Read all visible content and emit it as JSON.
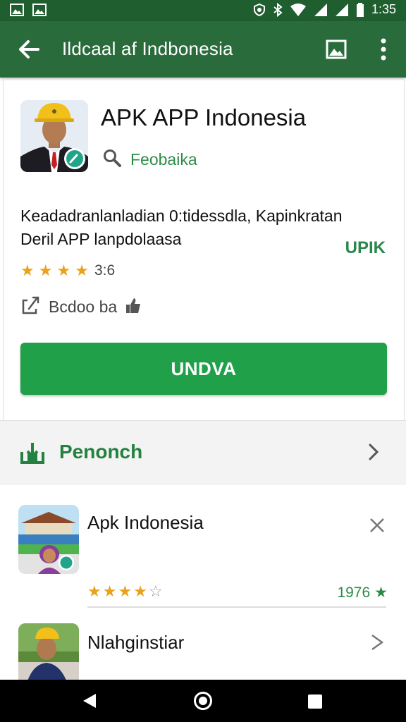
{
  "status_bar": {
    "time": "1:35",
    "icons": [
      "image-icon",
      "image-icon",
      "alarm-icon",
      "bluetooth-icon",
      "wifi-icon",
      "signal-icon",
      "signal-icon",
      "battery-icon"
    ]
  },
  "app_bar": {
    "title": "Ildcaal af Indbonesia",
    "back_icon": "arrow-left-icon",
    "image_icon": "image-icon",
    "more_icon": "more-vert-icon"
  },
  "app": {
    "name": "APK APP Indonesia",
    "developer": "Feobaika",
    "description_line1": "Keadadranlanladian 0:tidessdla, Kapinkratan",
    "description_line2": "Deril APP lanpdolaasa",
    "tag": "UPIK",
    "rating": "3:6",
    "stars_filled": 3.5,
    "share_label": "Bcdoo ba",
    "install_label": "UNDVA"
  },
  "section": {
    "label": "Penonch"
  },
  "list": [
    {
      "title": "Apk Indonesia",
      "stars_filled": 3.5,
      "count": "1976"
    },
    {
      "title": "Nlahginstiar"
    }
  ],
  "colors": {
    "status_bar": "#1f5e2f",
    "app_bar": "#2a6b3c",
    "accent_green": "#21a04a",
    "star_gold": "#e9a21d"
  }
}
